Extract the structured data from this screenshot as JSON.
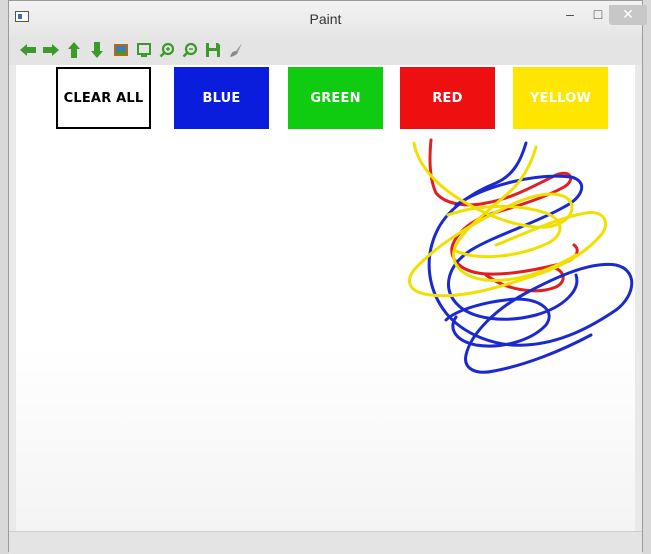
{
  "window": {
    "title": "Paint",
    "minimize_label": "–",
    "maximize_label": "□",
    "close_label": "✕"
  },
  "toolbar": {
    "tools": [
      {
        "name": "left-arrow-icon",
        "color": "#3a9a2a"
      },
      {
        "name": "right-arrow-icon",
        "color": "#3a9a2a"
      },
      {
        "name": "up-arrow-icon",
        "color": "#3a9a2a"
      },
      {
        "name": "down-arrow-icon",
        "color": "#3a9a2a"
      },
      {
        "name": "image-icon",
        "color": "#b06a1a"
      },
      {
        "name": "crop-icon",
        "color": "#3a9a2a"
      },
      {
        "name": "zoom-in-icon",
        "color": "#3a9a2a"
      },
      {
        "name": "zoom-out-icon",
        "color": "#3a9a2a"
      },
      {
        "name": "save-icon",
        "color": "#3a9a2a"
      },
      {
        "name": "brush-icon",
        "color": "#9a9a9a"
      }
    ]
  },
  "color_buttons": {
    "clear": "CLEAR ALL",
    "blue": "BLUE",
    "green": "GREEN",
    "red": "RED",
    "yellow": "YELLOW"
  },
  "colors": {
    "blue": "#0a1ddc",
    "green": "#10cc10",
    "red": "#ee1010",
    "yellow": "#ffe600",
    "stroke_blue": "#1a2ad0",
    "stroke_red": "#e02020",
    "stroke_yellow": "#f0e000"
  }
}
